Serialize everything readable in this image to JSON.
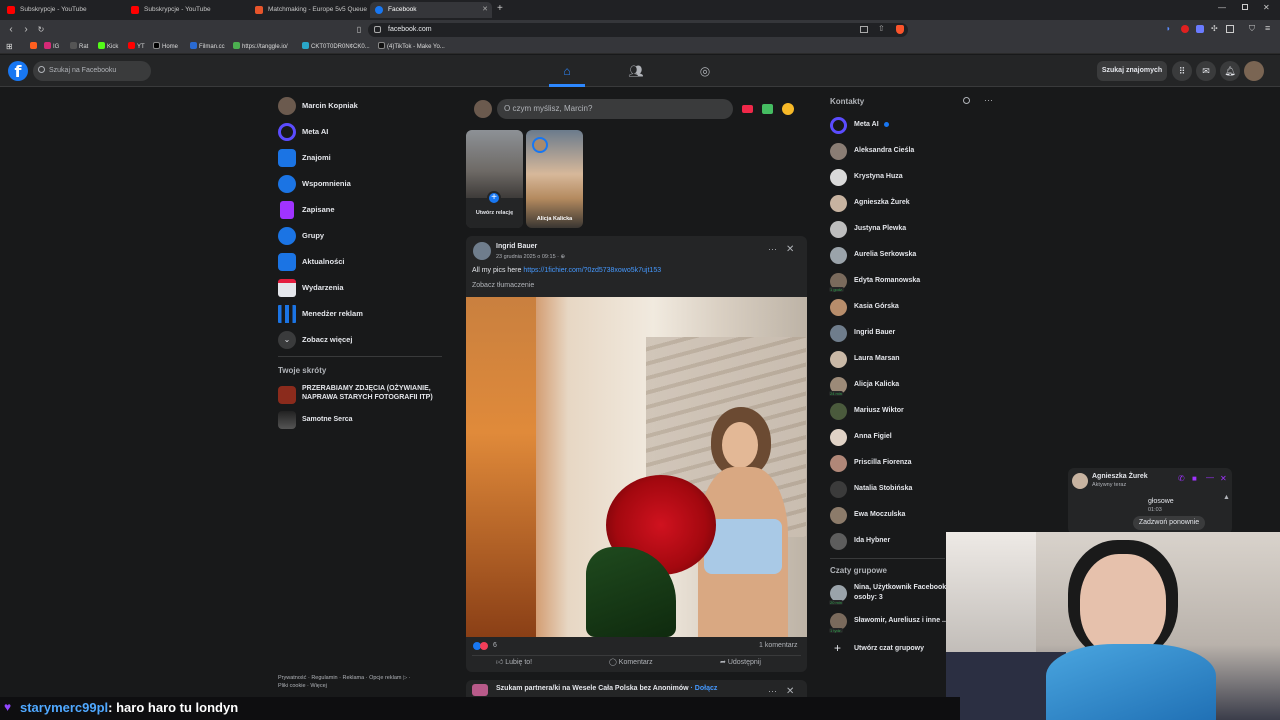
{
  "browser": {
    "tabs": [
      {
        "label": "Subskrypcje - YouTube",
        "color": "#ff0000"
      },
      {
        "label": "Subskrypcje - YouTube",
        "color": "#ff0000"
      },
      {
        "label": "Matchmaking - Europe 5v5 Queue",
        "color": "#e8552b"
      },
      {
        "label": "Facebook",
        "color": "#1877f2",
        "active": true
      }
    ],
    "new_tab_icon": "plus-icon",
    "url": "facebook.com",
    "bookmarks": [
      "IG",
      "Rat",
      "Kick",
      "YT",
      "Home",
      "Filman.cc",
      "https://tanggle.io/",
      "CKT0T0DR0N¢CK0...",
      "(4)TikTok - Make Yo..."
    ]
  },
  "header": {
    "logo": "f",
    "search_placeholder": "Szukaj na Facebooku",
    "find_friends": "Szukaj znajomych"
  },
  "left_nav": {
    "items": [
      {
        "label": "Marcin Kopniak",
        "icon": "avatar",
        "color": "#6b5a4e"
      },
      {
        "label": "Meta AI",
        "icon": "meta-ai-icon",
        "color": "#5b4cff"
      },
      {
        "label": "Znajomi",
        "icon": "friends-icon",
        "color": "#1b74e4"
      },
      {
        "label": "Wspomnienia",
        "icon": "clock-icon",
        "color": "#1b74e4"
      },
      {
        "label": "Zapisane",
        "icon": "bookmark-icon",
        "color": "#a033ff"
      },
      {
        "label": "Grupy",
        "icon": "groups-icon",
        "color": "#1b74e4"
      },
      {
        "label": "Aktualności",
        "icon": "feed-icon",
        "color": "#1b74e4"
      },
      {
        "label": "Wydarzenia",
        "icon": "calendar-icon",
        "color": "#e4e6eb"
      },
      {
        "label": "Menedżer reklam",
        "icon": "chart-icon",
        "color": "#1b74e4"
      },
      {
        "label": "Zobacz więcej",
        "icon": "chevron-down-icon",
        "color": "#3a3b3c"
      }
    ],
    "shortcuts_title": "Twoje skróty",
    "shortcuts": [
      {
        "label": "PRZERABIAMY ZDJĘCIA (OŻYWIANIE, NAPRAWA STARYCH FOTOGRAFII ITP)"
      },
      {
        "label": "Samotne Serca"
      }
    ],
    "footer_line1": "Prywatność · Regulamin · Reklama · Opcje reklam ▷ ·",
    "footer_line2": "Pliki cookie · Więcej"
  },
  "composer": {
    "placeholder": "O czym myślisz, Marcin?"
  },
  "stories": [
    {
      "label": "Utwórz relację"
    },
    {
      "label": "Alicja Kalicka"
    }
  ],
  "post": {
    "author": "Ingrid Bauer",
    "time": "23 grudnia 2025 o 09:15 ·",
    "text": "All my pics here",
    "link": "https://1fichier.com/?0zd5738xowo5k7ujt153",
    "translate": "Zobacz tłumaczenie",
    "reactions_count": "6",
    "comments_count": "1 komentarz",
    "like": "Lubię to!",
    "comment": "Komentarz",
    "share": "Udostępnij"
  },
  "next_post": {
    "text": "Szukam partnera/ki na Wesele Cała Polska bez Anonimów",
    "join": "· Dołącz"
  },
  "contacts": {
    "title": "Kontakty",
    "items": [
      {
        "name": "Meta AI",
        "color": "#5b4cff",
        "badge": ""
      },
      {
        "name": "Aleksandra Cieśla",
        "color": "#8a7d74",
        "badge": ""
      },
      {
        "name": "Krystyna Huza",
        "color": "#d9d9d9",
        "badge": ""
      },
      {
        "name": "Agnieszka Żurek",
        "color": "#c7b3a0",
        "badge": ""
      },
      {
        "name": "Justyna Plewka",
        "color": "#bdbdbd",
        "badge": ""
      },
      {
        "name": "Aurelia Serkowska",
        "color": "#9aa3aa",
        "badge": ""
      },
      {
        "name": "Edyta Romanowska",
        "color": "#7a6a5c",
        "badge": "1 godz."
      },
      {
        "name": "Kasia Górska",
        "color": "#b78d6b",
        "badge": ""
      },
      {
        "name": "Ingrid Bauer",
        "color": "#6f7d8c",
        "badge": ""
      },
      {
        "name": "Laura Marsan",
        "color": "#c9b8a6",
        "badge": ""
      },
      {
        "name": "Alicja Kalicka",
        "color": "#9c8a78",
        "badge": "24 min"
      },
      {
        "name": "Mariusz Wiktor",
        "color": "#4a5a3c",
        "badge": ""
      },
      {
        "name": "Anna Figiel",
        "color": "#e0d2c6",
        "badge": ""
      },
      {
        "name": "Priscilla Fiorenza",
        "color": "#b08778",
        "badge": ""
      },
      {
        "name": "Natalia Stobińska",
        "color": "#3b3b3b",
        "badge": ""
      },
      {
        "name": "Ewa Moczulska",
        "color": "#8c7b6a",
        "badge": ""
      },
      {
        "name": "Ida Hybner",
        "color": "#5d5d5d",
        "badge": ""
      }
    ],
    "groups_title": "Czaty grupowe",
    "groups": [
      {
        "name": "Nina, Użytkownik Facebooka",
        "sub": "osoby: 3",
        "badge": "20 min"
      },
      {
        "name": "Sławomir, Aureliusz i inne ...",
        "sub": "",
        "badge": "1 tydz."
      }
    ],
    "create_group": "Utwórz czat grupowy"
  },
  "chat_popup": {
    "name": "Agnieszka Żurek",
    "status": "Aktywny teraz",
    "call_label": "głosowe",
    "call_time": "01:03",
    "recall": "Zadzwoń ponownie"
  },
  "overlay": {
    "chat_user": "starymerc99pl",
    "chat_message": ": haro haro tu londyn"
  }
}
